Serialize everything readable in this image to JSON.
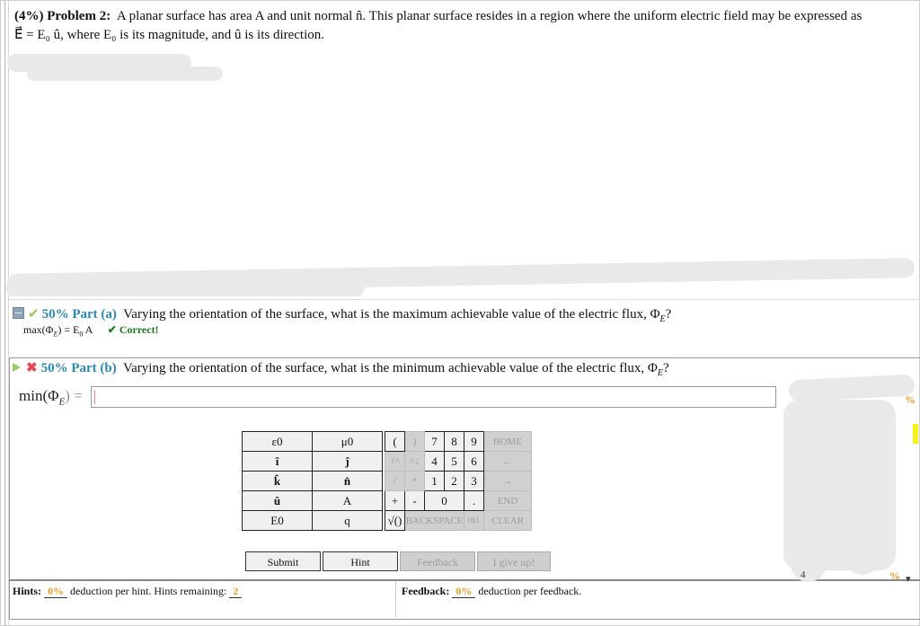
{
  "problem": {
    "weight": "(4%)",
    "title": "Problem 2:",
    "text_line1": "A planar surface has area A and unit normal n̂. This planar surface resides in a region where the uniform electric field may be expressed as",
    "text_line2": "E⃗ = E₀ û, where E₀ is its magnitude, and û is its direction."
  },
  "part_a": {
    "percent": "50%",
    "label": "Part (a)",
    "question": "Varying the orientation of the surface, what is the maximum achievable value of the electric flux, Φ_E?",
    "question_prefix": "Varying the orientation of the surface, what is the maximum achievable value of the electric flux, Φ",
    "question_sub": "E",
    "answer": "max(ΦE) = E0 A",
    "answer_lhs": "max(Φ",
    "answer_sub": "E",
    "answer_rhs": ") = E",
    "answer_sub2": "0",
    "answer_tail": " A",
    "status": "✔ Correct!",
    "state": "correct"
  },
  "part_b": {
    "percent": "50%",
    "label": "Part (b)",
    "question_prefix": "Varying the orientation of the surface, what is the minimum achievable value of the electric flux, Φ",
    "question_sub": "E",
    "input_label_pre": "min(Φ",
    "input_label_sub": "E",
    "input_label_post": ") =",
    "input_value": "",
    "state": "incorrect"
  },
  "keypad": {
    "symbols": [
      [
        "ε0",
        "μ0"
      ],
      [
        "î",
        "ĵ"
      ],
      [
        "k̂",
        "n̂"
      ],
      [
        "û",
        "A"
      ],
      [
        "E0",
        "q"
      ]
    ],
    "numeric": {
      "row1": [
        "(",
        ")",
        "7",
        "8",
        "9",
        "HOME"
      ],
      "row2": [
        "↑^",
        "^↓",
        "4",
        "5",
        "6",
        "←"
      ],
      "row3": [
        "/",
        "*",
        "1",
        "2",
        "3",
        "→"
      ],
      "row4": [
        "+",
        "-",
        "0",
        ".",
        "END"
      ],
      "row5": [
        "√()",
        "BACKSPACE",
        "DEL",
        "CLEAR"
      ]
    }
  },
  "buttons": {
    "submit": "Submit",
    "hint": "Hint",
    "feedback": "Feedback",
    "give_up": "I give up!"
  },
  "hints": {
    "label": "Hints:",
    "deduction": "0%",
    "text": "deduction per hint. Hints remaining:",
    "remaining": "2"
  },
  "feedback": {
    "label": "Feedback:",
    "deduction": "0%",
    "text": "deduction per feedback."
  },
  "side": {
    "pct1": "%",
    "pct2": "%",
    "num": "4"
  }
}
